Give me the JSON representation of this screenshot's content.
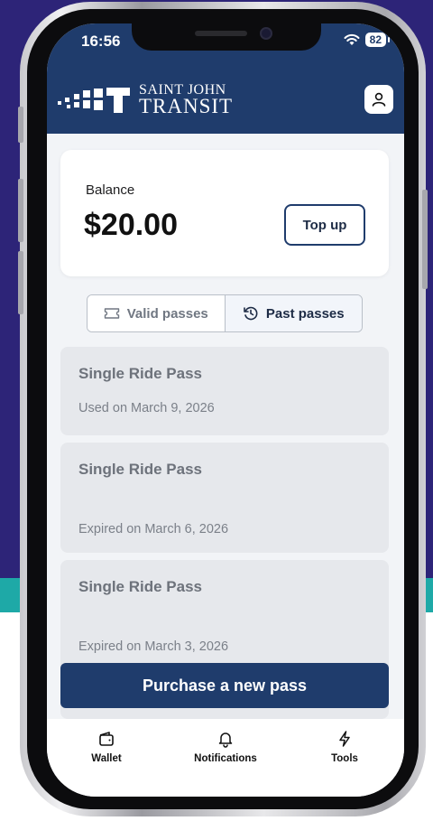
{
  "status_bar": {
    "time": "16:56",
    "battery": "82"
  },
  "header": {
    "logo_line1": "SAINT JOHN",
    "logo_line2": "TRANSIT"
  },
  "balance": {
    "label": "Balance",
    "amount": "$20.00",
    "topup_label": "Top up"
  },
  "tabs": {
    "valid_label": "Valid passes",
    "past_label": "Past passes",
    "active": "past"
  },
  "passes": [
    {
      "title": "Single Ride Pass",
      "status": "Used on March 9, 2026"
    },
    {
      "title": "Single Ride Pass",
      "status": "Expired on March 6, 2026"
    },
    {
      "title": "Single Ride Pass",
      "status": "Expired on March 3, 2026"
    }
  ],
  "purchase_label": "Purchase a new pass",
  "nav": [
    {
      "label": "Wallet",
      "icon": "wallet-icon"
    },
    {
      "label": "Notifications",
      "icon": "bell-icon"
    },
    {
      "label": "Tools",
      "icon": "lightning-icon"
    }
  ],
  "colors": {
    "brand_navy": "#1f3c6c",
    "bg_purple": "#2d2478",
    "bg_teal": "#1ea9a7",
    "card_grey": "#e6e8ec"
  }
}
